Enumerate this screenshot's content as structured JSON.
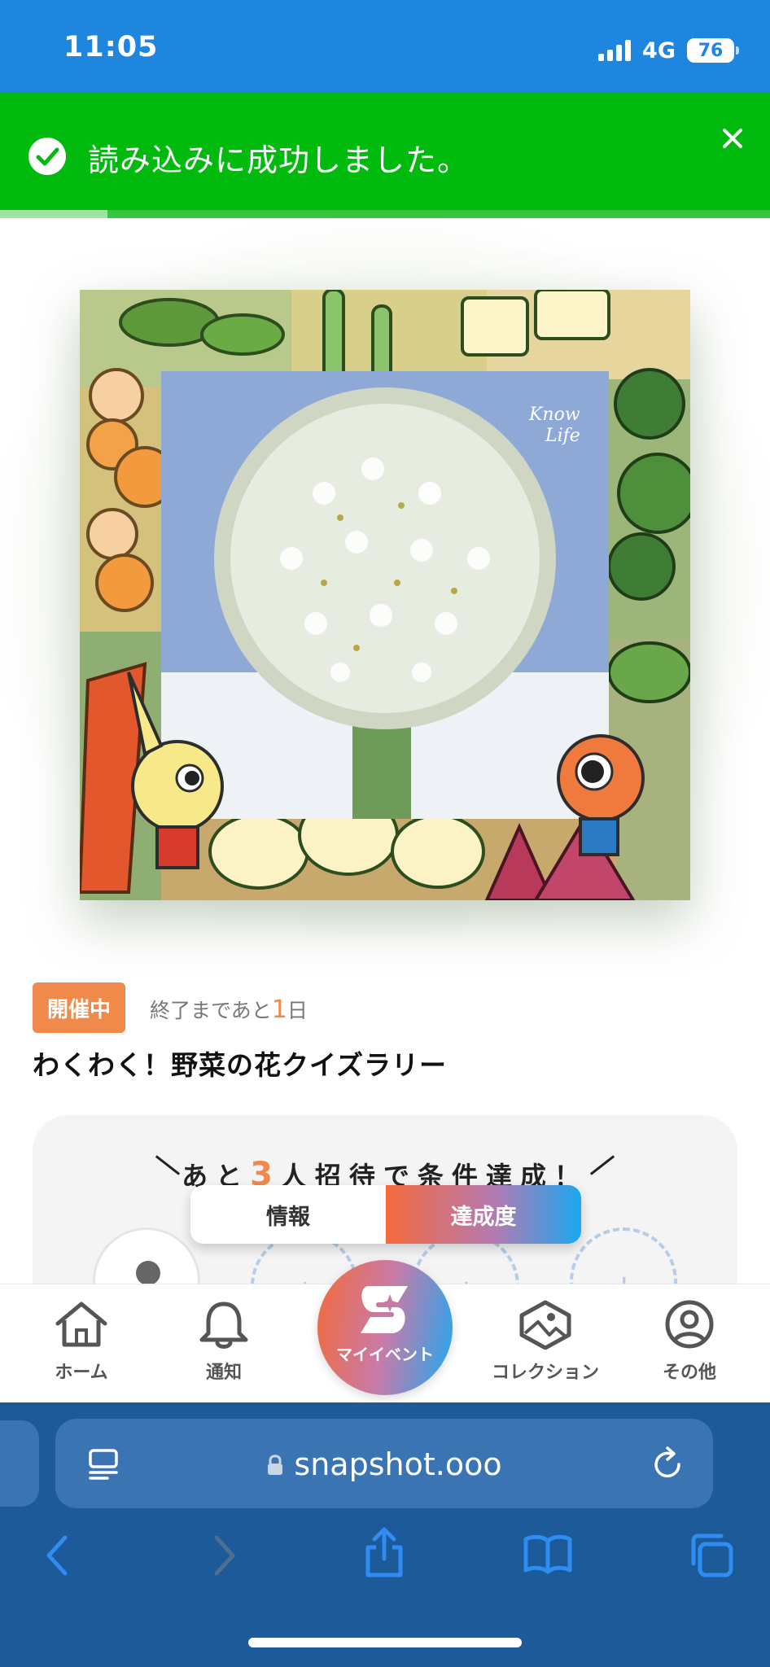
{
  "status_bar": {
    "time": "11:05",
    "network": "4G",
    "battery": "76"
  },
  "toast": {
    "message": "読み込みに成功しました。",
    "progress": 0.14
  },
  "event": {
    "status_badge": "開催中",
    "remaining_prefix": "終了まであと",
    "remaining_number": "1",
    "remaining_suffix": "日",
    "title": "わくわく！野菜の花クイズラリー",
    "image_logo_text": "Know Life"
  },
  "progress_card": {
    "invite_prefix": "あと",
    "invite_number": "3",
    "invite_suffix": "人招待で条件達成！"
  },
  "segment": {
    "info_label": "情報",
    "achievement_label": "達成度",
    "selected": "達成度"
  },
  "tabbar": {
    "home": "ホーム",
    "notifications": "通知",
    "my_events": "マイイベント",
    "collection": "コレクション",
    "other": "その他"
  },
  "browser": {
    "url": "snapshot.ooo"
  },
  "icons": [
    "check-circle-icon",
    "close-icon",
    "home-icon",
    "bell-icon",
    "brand-s-icon",
    "collection-icon",
    "account-icon",
    "reader-icon",
    "lock-icon",
    "reload-icon",
    "back-icon",
    "forward-icon",
    "share-icon",
    "bookmarks-icon",
    "tabs-icon"
  ],
  "colors": {
    "status_bar": "#1f86e0",
    "toast": "#00ba0e",
    "badge": "#f08a4b",
    "browser": "#1c5a9a"
  }
}
